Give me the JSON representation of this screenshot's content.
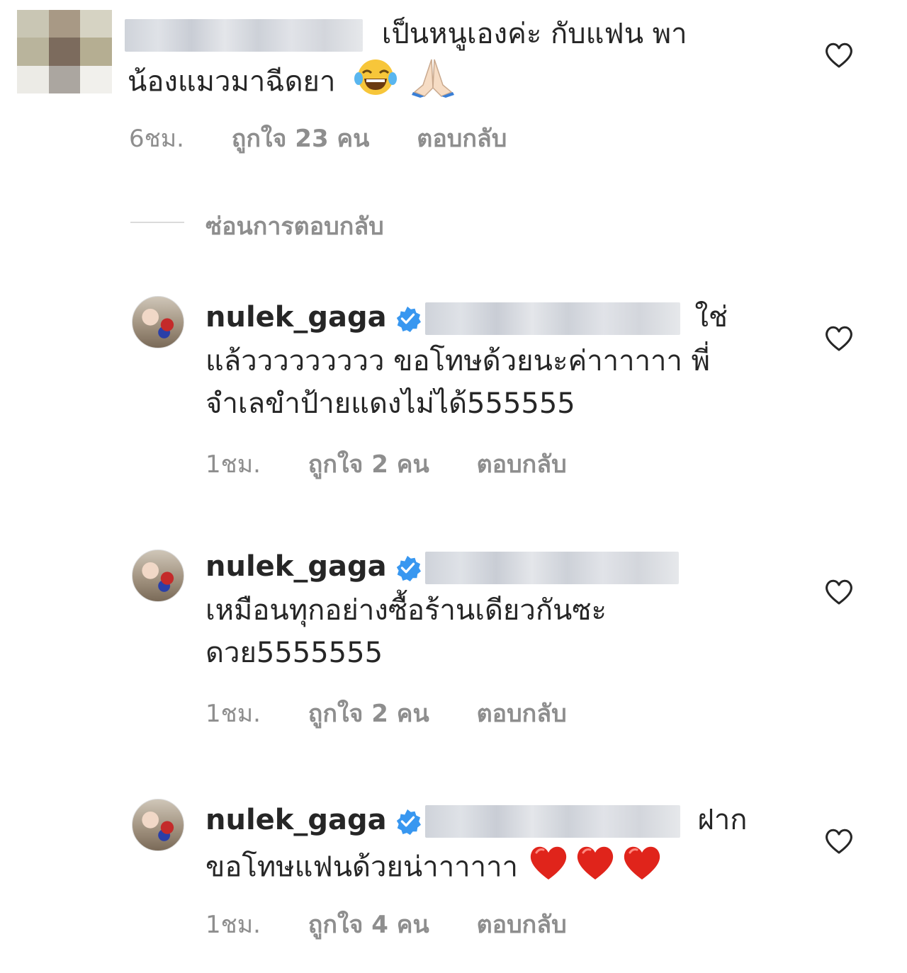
{
  "comments": [
    {
      "text_line1": "เป็นหนูเองค่ะ กับแฟน พา",
      "text_line2": "น้องแมวมาฉีดยา",
      "time": "6ชม.",
      "likes": "ถูกใจ 23 คน",
      "reply": "ตอบกลับ"
    }
  ],
  "hide_replies_label": "ซ่อนการตอบกลับ",
  "replies": [
    {
      "username": "nulek_gaga",
      "line1_suffix": "ใช่",
      "line2": "แล้ววววววววว  ขอโทษด้วยนะค่าาาาาา พี่",
      "line3": "จำเลขำป้ายแดงไม่ได้555555",
      "time": "1ชม.",
      "likes": "ถูกใจ 2 คน",
      "reply": "ตอบกลับ"
    },
    {
      "username": "nulek_gaga",
      "line2": "เหมือนทุกอย่างซื้อร้านเดียวกันซะ",
      "line3": "ดวย5555555",
      "time": "1ชม.",
      "likes": "ถูกใจ 2 คน",
      "reply": "ตอบกลับ"
    },
    {
      "username": "nulek_gaga",
      "line1_suffix": "ฝาก",
      "line2": "ขอโทษแฟนด้วยน่าาาาาา",
      "time": "1ชม.",
      "likes": "ถูกใจ 4 คน",
      "reply": "ตอบกลับ"
    }
  ],
  "icons": {
    "heart": "heart-outline-icon",
    "verified": "verified-badge-icon",
    "laugh": "face-with-tears-of-joy-emoji",
    "pray": "folded-hands-emoji",
    "red_heart": "red-heart-emoji"
  },
  "colors": {
    "text": "#262626",
    "meta": "#8e8e8e",
    "verified": "#3897f0",
    "heart_emoji": "#e0241b"
  }
}
